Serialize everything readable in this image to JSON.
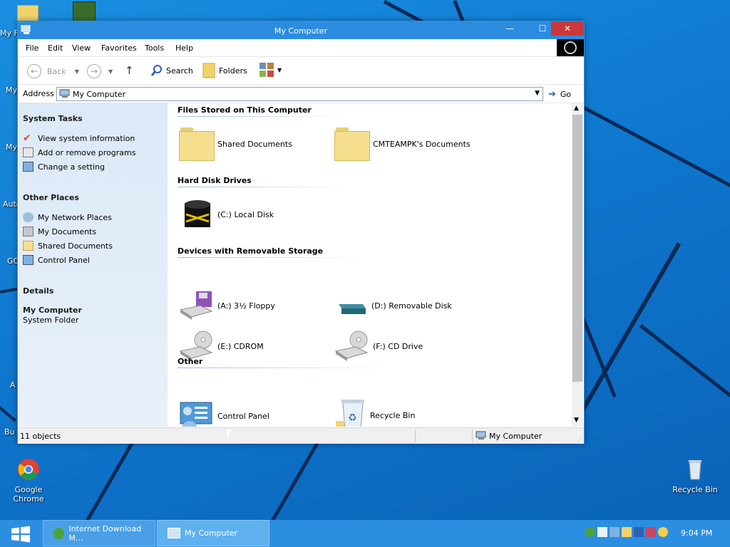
{
  "window": {
    "title": "My Computer",
    "controls": {
      "minimize": "—",
      "maximize": "☐",
      "close": "✕"
    }
  },
  "menu": [
    "File",
    "Edit",
    "View",
    "Favorites",
    "Tools",
    "Help"
  ],
  "toolbar": {
    "back": "Back",
    "search": "Search",
    "folders": "Folders"
  },
  "address": {
    "label": "Address",
    "value": "My Computer",
    "go": "Go"
  },
  "left_panel": {
    "system_tasks": {
      "title": "System Tasks",
      "items": [
        "View system information",
        "Add or remove programs",
        "Change a setting"
      ]
    },
    "other_places": {
      "title": "Other Places",
      "items": [
        "My Network Places",
        "My Documents",
        "Shared Documents",
        "Control Panel"
      ]
    },
    "details": {
      "title": "Details",
      "name": "My Computer",
      "type": "System Folder"
    }
  },
  "content": {
    "groups": [
      {
        "title": "Files Stored on This Computer",
        "items": [
          "Shared Documents",
          "CMTEAMPK's Documents"
        ]
      },
      {
        "title": "Hard Disk Drives",
        "items": [
          "(C:) Local Disk"
        ]
      },
      {
        "title": "Devices with Removable Storage",
        "items": [
          "(A:) 3½ Floppy",
          "(D:) Removable Disk",
          "(E:) CDROM",
          "(F:) CD Drive"
        ]
      },
      {
        "title": "Other",
        "items": [
          "Control Panel",
          "Recycle Bin"
        ]
      }
    ]
  },
  "status": {
    "count": "11 objects",
    "location": "My Computer"
  },
  "desktop": {
    "icons": [
      {
        "label": "Google Chrome"
      },
      {
        "label": "Recycle Bin"
      }
    ],
    "cut_labels": [
      "My F",
      "My",
      "My",
      "Auto",
      "GO",
      "A",
      "Bu"
    ]
  },
  "taskbar": {
    "tasks": [
      "Internet Download M...",
      "My Computer"
    ],
    "clock": "9:04 PM"
  },
  "colors": {
    "titlebar": "#2b8ce0",
    "close": "#c7393a",
    "taskbar": "#2c8ee0",
    "leftpane": "#dce9f7"
  }
}
